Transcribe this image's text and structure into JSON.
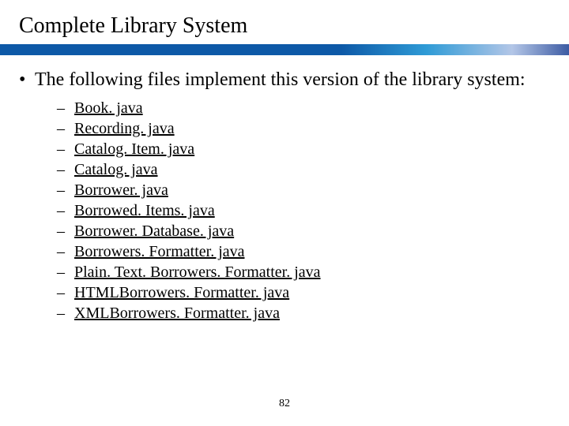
{
  "title": "Complete Library System",
  "intro_bullet": "The following files implement this version of the library system:",
  "files": [
    "Book. java",
    "Recording. java",
    "Catalog. Item. java",
    "Catalog. java",
    "Borrower. java",
    "Borrowed. Items. java",
    "Borrower. Database. java",
    "Borrowers. Formatter. java",
    "Plain. Text. Borrowers. Formatter. java",
    "HTMLBorrowers. Formatter. java",
    "XMLBorrowers. Formatter. java"
  ],
  "glyphs": {
    "dot": "•",
    "dash": "–"
  },
  "page_number": "82"
}
